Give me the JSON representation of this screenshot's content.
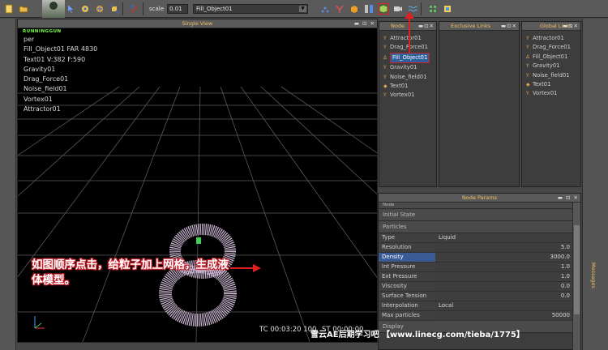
{
  "toolbar": {
    "scale_label": "scale",
    "scale_value": "0.01",
    "object_select": "Fill_Object01"
  },
  "viewport": {
    "title": "Single View",
    "brand": "RUNNINGGUN",
    "lines": [
      "per",
      "Fill_Object01 FAR 4830",
      "Text01 V:382 F:590",
      "Gravity01",
      "Drag_Force01",
      "Noise_field01",
      "Vortex01",
      "Attractor01"
    ],
    "timecode": "TC 00:03:20 100",
    "status": "ST 00:00:00",
    "caption": "如图顺序点击，给粒子加上网格，生成液体模型。"
  },
  "nodes_panel": {
    "title": "Node",
    "items": [
      {
        "icon": "Y",
        "label": "Attractor01"
      },
      {
        "icon": "Y",
        "label": "Drag_Force01"
      },
      {
        "icon": "Δ",
        "label": "Fill_Object01",
        "selected": true
      },
      {
        "icon": "Y",
        "label": "Gravity01"
      },
      {
        "icon": "Y",
        "label": "Noise_field01"
      },
      {
        "icon": "◆",
        "label": "Text01"
      },
      {
        "icon": "Y",
        "label": "Vortex01"
      }
    ]
  },
  "exclusive_panel": {
    "title": "Exclusive Links"
  },
  "global_panel": {
    "title": "Global Links",
    "items": [
      {
        "icon": "Y",
        "label": "Attractor01"
      },
      {
        "icon": "Y",
        "label": "Drag_Force01"
      },
      {
        "icon": "Δ",
        "label": "Fill_Object01"
      },
      {
        "icon": "Y",
        "label": "Gravity01"
      },
      {
        "icon": "Y",
        "label": "Noise_field01"
      },
      {
        "icon": "◆",
        "label": "Text01"
      },
      {
        "icon": "Y",
        "label": "Vortex01"
      }
    ]
  },
  "params_panel": {
    "title": "Node Params",
    "sections": [
      "Node",
      "Initial State",
      "Particles"
    ],
    "rows": [
      {
        "key": "Type",
        "value": "Liquid",
        "num": false
      },
      {
        "key": "Resolution",
        "value": "5.0",
        "num": true
      },
      {
        "key": "Density",
        "value": "3000.0",
        "num": true,
        "highlight": true
      },
      {
        "key": "Int Pressure",
        "value": "1.0",
        "num": true
      },
      {
        "key": "Ext Pressure",
        "value": "1.0",
        "num": true
      },
      {
        "key": "Viscosity",
        "value": "0.0",
        "num": true
      },
      {
        "key": "Surface Tension",
        "value": "0.0",
        "num": true
      },
      {
        "key": "Interpolation",
        "value": "Local",
        "num": false
      },
      {
        "key": "Max particles",
        "value": "50000",
        "num": true
      }
    ],
    "footer_section": "Display"
  },
  "messages_tab": "Messages",
  "watermark": "雪云AE后期学习吧 【www.linecg.com/tieba/1775】"
}
